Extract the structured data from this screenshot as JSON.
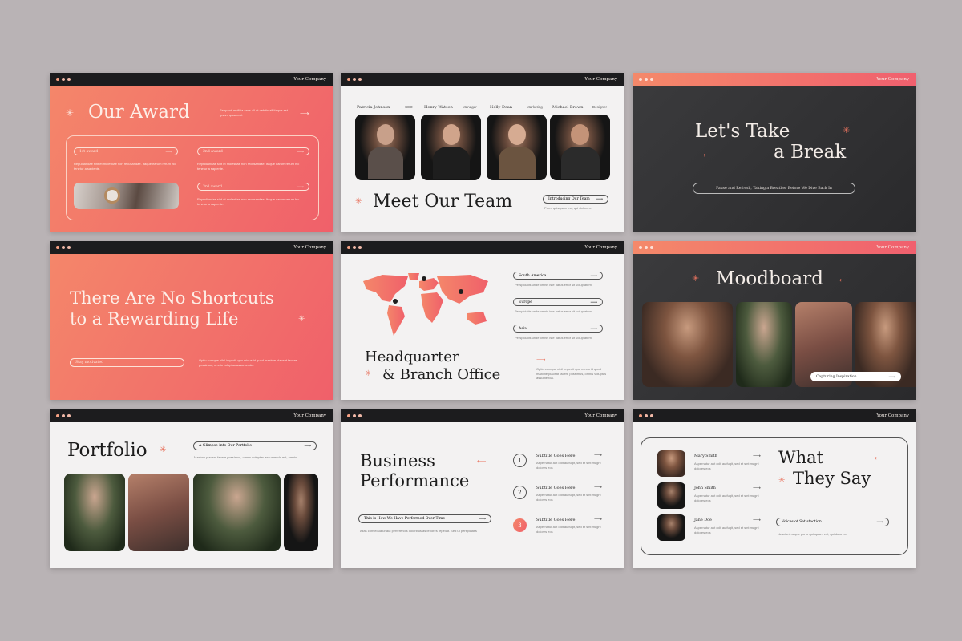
{
  "company": "Your Company",
  "award": {
    "title": "Our Award",
    "desc": "Seepanit mollitia sens all ut debitis all Itaque est Ipsum quaerent.",
    "items": [
      {
        "label": "1st award",
        "text": "Repudiandae sint et molestiae non recusandae. Itaque earum rerum hic tenetur a sapiente."
      },
      {
        "label": "2nd award",
        "text": "Repudiandae sint et molestiae non recusandae. Itaque earum rerum hic tenetur a sapiente."
      },
      {
        "label": "3rd award",
        "text": "Repudiandae sint et molestiae non recusandae. Itaque earum rerum hic tenetur a sapiente."
      }
    ]
  },
  "team": {
    "title": "Meet Our Team",
    "button": "Introducing Our Team",
    "note": "Porro quisquam est, qui dolorem.",
    "members": [
      {
        "name": "Patricia Johnson",
        "role": "CEO"
      },
      {
        "name": "Henry Watson",
        "role": "Manager"
      },
      {
        "name": "Nelly Dean",
        "role": "Marketing"
      },
      {
        "name": "Michael Brown",
        "role": "Designer"
      }
    ]
  },
  "break": {
    "line1": "Let's Take",
    "line2": "a Break",
    "pill": "Pause and Refresh, Taking a Breather Before We Dive Back In"
  },
  "shortcuts": {
    "line1": "There Are No Shortcuts",
    "line2": "to a Rewarding Life",
    "pill": "Stay motivated",
    "text": "Optio cumque nihil impedit quo minus id quod maxime placeat facere possimus, omnis voluptas assumenda."
  },
  "hq": {
    "line1": "Headquarter",
    "line2": "& Branch Office",
    "text": "Optio cumque nihil impedit quo minus id quod maxime placeat facere possimus, omnis voluptas assumenda.",
    "regions": [
      {
        "name": "South America",
        "text": "Perspiciatis unde omnis iste natus error sit voluptatem."
      },
      {
        "name": "Europe",
        "text": "Perspiciatis unde omnis iste natus error sit voluptatem."
      },
      {
        "name": "Asia",
        "text": "Perspiciatis unde omnis iste natus error sit voluptatem."
      }
    ]
  },
  "mood": {
    "title": "Moodboard",
    "pill": "Capturing Inspiration"
  },
  "portfolio": {
    "title": "Portfolio",
    "pill": "A Glimpse into Our Portfolio",
    "text": "Maxime placeat facere possimus, omnis voluptas assumenda est, omnis"
  },
  "business": {
    "line1": "Business",
    "line2": "Performance",
    "pill": "This is How We Have Performed Over Time",
    "text": "Alias consequatur aut perferendis doloribus asperiores repellat. Sed ut perspiciatis",
    "steps": [
      {
        "num": "1",
        "title": "Subtitle Goes Here",
        "text": "Aspernatur aut odit autfugit, sed et sint magni dolores eos"
      },
      {
        "num": "2",
        "title": "Subtitle Goes Here",
        "text": "Aspernatur aut odit autfugit, sed et sint magni dolores eos"
      },
      {
        "num": "3",
        "title": "Subtitle Goes Here",
        "text": "Aspernatur aut odit autfugit, sed et sint magni dolores eos"
      }
    ]
  },
  "testimonials": {
    "line1": "What",
    "line2": "They Say",
    "pill": "Voices of Satisfaction",
    "text": "Nesciunt neque porro quisquam est, qui dolorem",
    "people": [
      {
        "name": "Mary Smith",
        "text": "Aspernatur aut odit autfugit, sed et sint magni dolores eos"
      },
      {
        "name": "John Smith",
        "text": "Aspernatur aut odit autfugit, sed et sint magni dolores eos"
      },
      {
        "name": "Jane Doe",
        "text": "Aspernatur aut odit autfugit, sed et sint magni dolores eos"
      }
    ]
  },
  "colors": {
    "accent": "#f0606a",
    "accent_light": "#f4876a",
    "dark": "#2e2e30",
    "light": "#f3f2f2"
  }
}
